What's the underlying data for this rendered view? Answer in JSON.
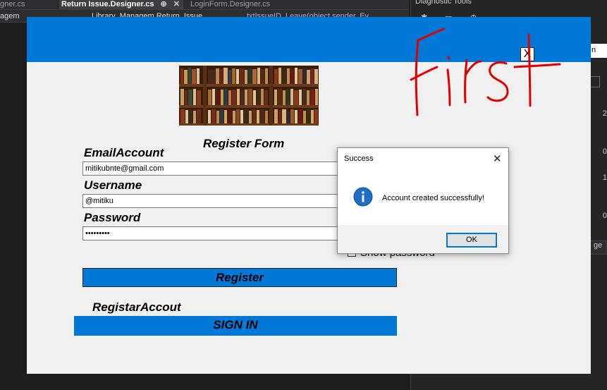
{
  "ide": {
    "tabs": [
      {
        "label": "gner.cs"
      },
      {
        "label": "Return Issue.Designer.cs",
        "pin": "⊕",
        "close": "✕"
      },
      {
        "label": "LoginForm.Designer.cs"
      }
    ],
    "nav": {
      "project": "agem",
      "class": "Library_Managem.Return_Issue",
      "member": "txtIssueID_Leave(object sender, Ev"
    },
    "right_panel_title": "Diagnostic Tools",
    "right_panel_numbers": [
      "2",
      "0",
      "1",
      "0"
    ],
    "right_tabs": [
      "n",
      "ge"
    ]
  },
  "app": {
    "window_close": "X",
    "form_title": "Register Form",
    "email_label": "EmailAccount",
    "email_value": "mitikubnte@gmail.com",
    "username_label": "Username",
    "username_value": "@mitiku",
    "password_label": "Password",
    "password_value": "•••••••••",
    "show_password_label": "Show password",
    "register_button": "Register",
    "account_label": "RegistarAccout",
    "signin_button": "SIGN IN"
  },
  "annotation": {
    "text": "First",
    "color": "#e00000"
  },
  "dialog": {
    "title": "Success",
    "close": "✕",
    "message": "Account created successfully!",
    "ok_label": "OK"
  },
  "colors": {
    "accent": "#0078d7",
    "ide_bg": "#1e1e1e"
  }
}
